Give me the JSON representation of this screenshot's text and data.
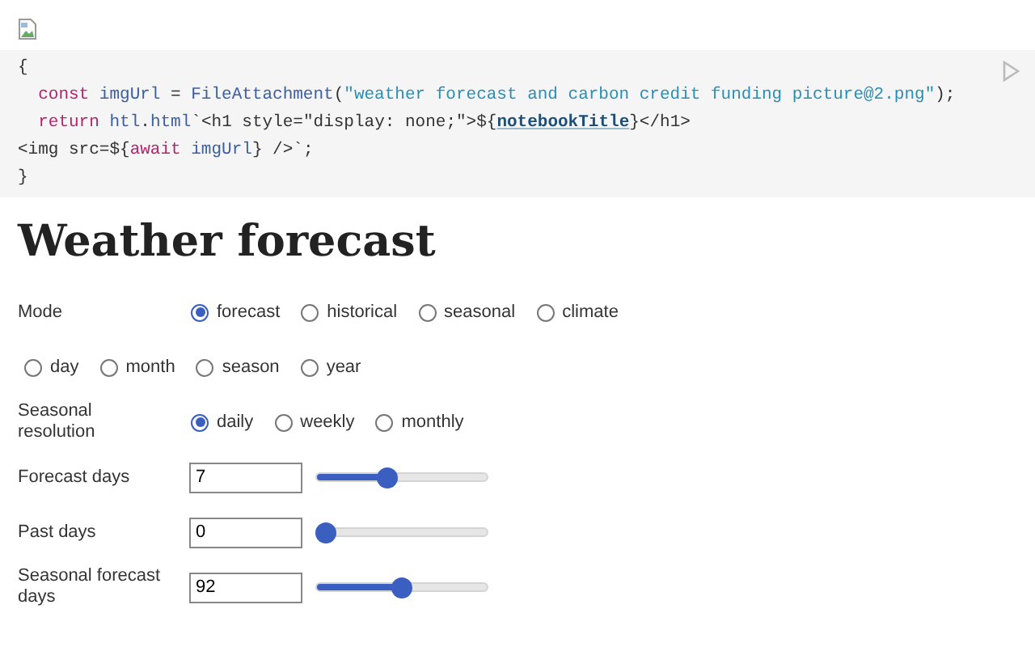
{
  "code_cell": {
    "lines": [
      [
        {
          "kind": "plain",
          "text": "{"
        }
      ],
      [
        {
          "kind": "keyword",
          "text": "  const"
        },
        {
          "kind": "name",
          "text": " imgUrl"
        },
        {
          "kind": "plain",
          "text": " = "
        },
        {
          "kind": "name",
          "text": "FileAttachment"
        },
        {
          "kind": "plain",
          "text": "("
        },
        {
          "kind": "string",
          "text": "\"weather forecast and carbon credit funding picture@2.png\""
        },
        {
          "kind": "plain",
          "text": ");"
        }
      ],
      [
        {
          "kind": "keyword",
          "text": "  return"
        },
        {
          "kind": "name",
          "text": " htl"
        },
        {
          "kind": "plain",
          "text": "."
        },
        {
          "kind": "name",
          "text": "html"
        },
        {
          "kind": "plain",
          "text": "`<h1 style=\"display: none;\">${"
        },
        {
          "kind": "link",
          "text": "notebookTitle"
        },
        {
          "kind": "plain",
          "text": "}</h1>"
        }
      ],
      [
        {
          "kind": "plain",
          "text": "<img src=${"
        },
        {
          "kind": "keyword",
          "text": "await"
        },
        {
          "kind": "name",
          "text": " imgUrl"
        },
        {
          "kind": "plain",
          "text": "} />`;"
        }
      ],
      [
        {
          "kind": "plain",
          "text": "}"
        }
      ]
    ]
  },
  "title": "Weather forecast",
  "form": [
    {
      "kind": "radio",
      "label": "Mode",
      "options": [
        {
          "label": "forecast",
          "selected": true
        },
        {
          "label": "historical",
          "selected": false
        },
        {
          "label": "seasonal",
          "selected": false
        },
        {
          "label": "climate",
          "selected": false
        }
      ]
    },
    {
      "kind": "radio",
      "options": [
        {
          "label": "day",
          "selected": false
        },
        {
          "label": "month",
          "selected": false
        },
        {
          "label": "season",
          "selected": false
        },
        {
          "label": "year",
          "selected": false
        }
      ]
    },
    {
      "kind": "radio",
      "label": "Seasonal resolution",
      "options": [
        {
          "label": "daily",
          "selected": true
        },
        {
          "label": "weekly",
          "selected": false
        },
        {
          "label": "monthly",
          "selected": false
        }
      ]
    },
    {
      "kind": "slider",
      "label": "Forecast days",
      "value": "7",
      "level": 0.4
    },
    {
      "kind": "slider",
      "label": "Past days",
      "value": "0",
      "level": 0
    },
    {
      "kind": "slider",
      "label": "Seasonal forecast days",
      "value": "92",
      "level": 0.5
    }
  ]
}
